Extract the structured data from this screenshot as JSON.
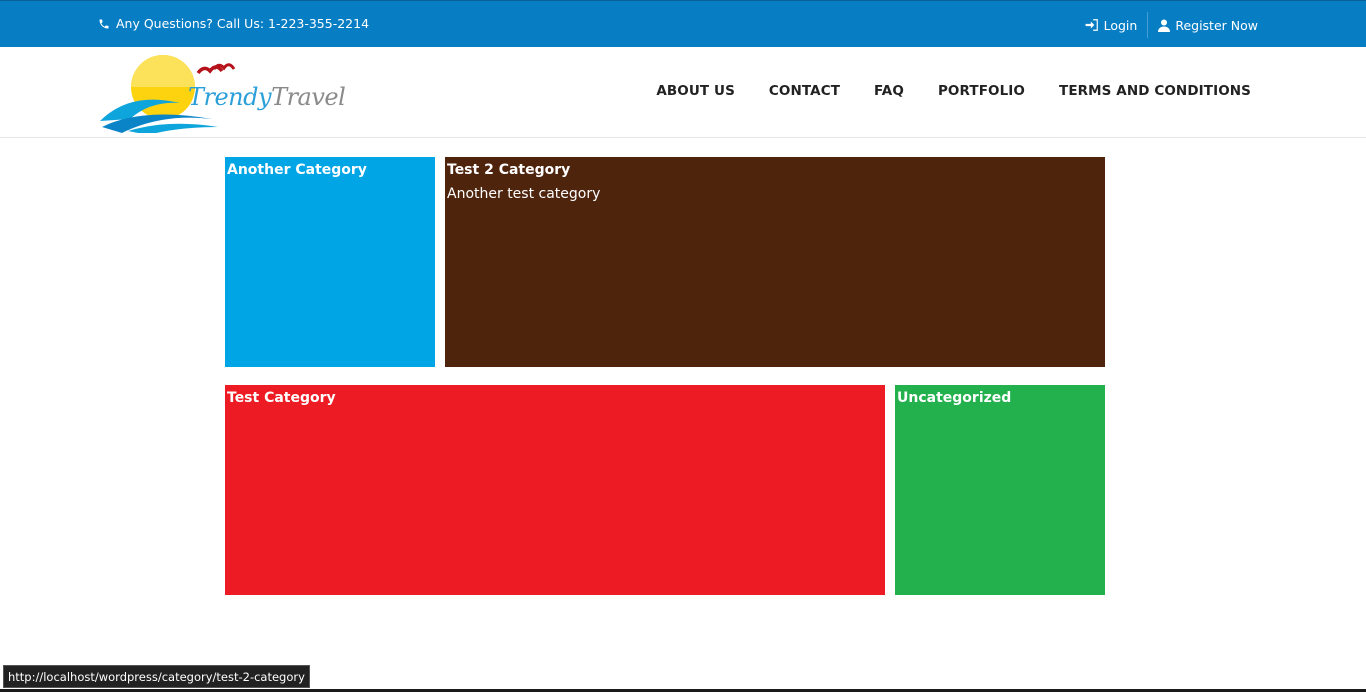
{
  "topbar": {
    "phone_text": "Any Questions? Call Us: 1-223-355-2214",
    "login_label": "Login",
    "register_label": "Register Now"
  },
  "header": {
    "logo": {
      "word1": "Trendy",
      "word2": "Travel"
    },
    "nav": [
      {
        "label": "ABOUT US"
      },
      {
        "label": "CONTACT"
      },
      {
        "label": "FAQ"
      },
      {
        "label": "PORTFOLIO"
      },
      {
        "label": "TERMS AND CONDITIONS"
      }
    ]
  },
  "categories": [
    {
      "title": "Another Category",
      "description": "",
      "color": "#00a5e6"
    },
    {
      "title": "Test 2 Category",
      "description": "Another test category",
      "color": "#4e240d"
    },
    {
      "title": "Test Category",
      "description": "",
      "color": "#ed1b24"
    },
    {
      "title": "Uncategorized",
      "description": "",
      "color": "#23b14d"
    }
  ],
  "status_url": "http://localhost/wordpress/category/test-2-category",
  "colors": {
    "topbar": "#077dc4",
    "nav_text": "#222222"
  }
}
